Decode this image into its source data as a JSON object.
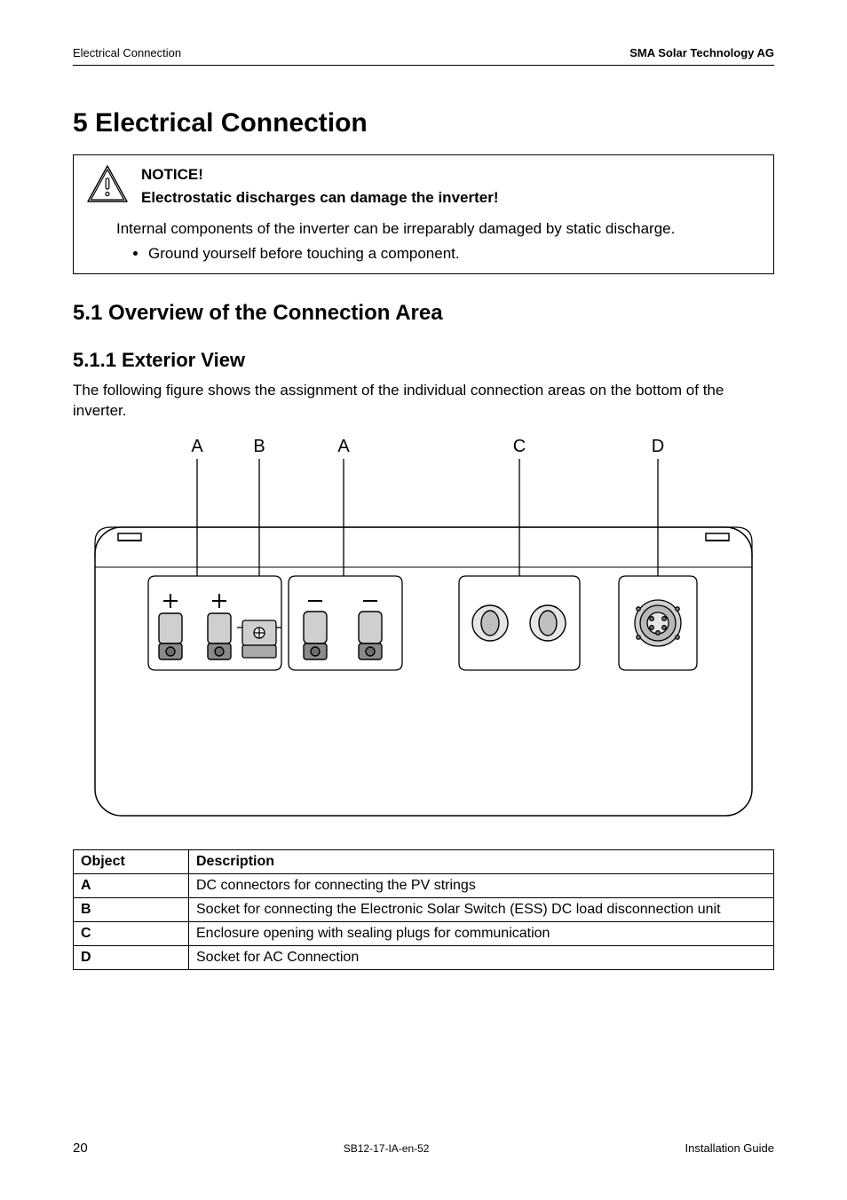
{
  "header": {
    "left": "Electrical Connection",
    "right": "SMA Solar Technology AG"
  },
  "chapter": {
    "number": "5",
    "title": "Electrical Connection",
    "full": "5 Electrical Connection"
  },
  "notice": {
    "label": "NOTICE!",
    "subheading": "Electrostatic discharges can damage the inverter!",
    "body": "Internal components of the inverter can be irreparably damaged by static discharge.",
    "bullet": "Ground yourself before touching a component."
  },
  "section": {
    "full": "5.1 Overview of the Connection Area"
  },
  "subsection": {
    "full": "5.1.1 Exterior View"
  },
  "paragraph": "The following figure shows the assignment of the individual connection areas on the bottom of the inverter.",
  "figure": {
    "labels": {
      "A": "A",
      "B": "B",
      "C": "C",
      "D": "D"
    }
  },
  "table": {
    "headers": {
      "object": "Object",
      "description": "Description"
    },
    "rows": [
      {
        "object": "A",
        "description": "DC connectors for connecting the PV strings"
      },
      {
        "object": "B",
        "description": "Socket for connecting the Electronic Solar Switch (ESS) DC load disconnection unit"
      },
      {
        "object": "C",
        "description": "Enclosure opening with sealing plugs for communication"
      },
      {
        "object": "D",
        "description": "Socket for AC Connection"
      }
    ]
  },
  "footer": {
    "page": "20",
    "doc": "SB12-17-IA-en-52",
    "guide": "Installation Guide"
  }
}
